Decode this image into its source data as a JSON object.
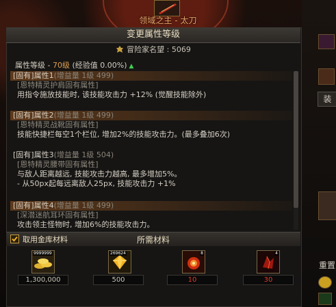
{
  "weapon": {
    "name": "领域之主 - 太刀"
  },
  "dialog": {
    "title": "变更属性等级"
  },
  "fame": {
    "label": "冒险家名望 : 5069"
  },
  "attr_level": {
    "prefix": "属性等级 - ",
    "level": "70级",
    "exp": " (经验值 0.00%)",
    "up_marker": "▲"
  },
  "attributes": [
    {
      "head": "[固有]属性1",
      "gain": "(增益量 1级 499)",
      "source": "[恩特精灵护肩固有属性]",
      "desc": [
        "用指令施放技能时, 该技能攻击力 +12% (觉醒技能除外)"
      ]
    },
    {
      "head": "[固有]属性2",
      "gain": "(增益量 1级 499)",
      "source": "[恩特精灵战靴固有属性]",
      "desc": [
        "技能快捷栏每空1个栏位, 增加2%的技能攻击力。(最多叠加6次)"
      ]
    },
    {
      "head": "[固有]属性3",
      "gain": "(增益量 1级 504)",
      "source": "[恩特精灵腰带固有属性]",
      "desc": [
        "与敌人距离越远, 技能攻击力越高, 最多增加5%。",
        "- 从50px起每远离敌人25px, 技能攻击力 +1%"
      ]
    },
    {
      "head": "[固有]属性4",
      "gain": "(增益量 1级 499)",
      "source": "[深潜迷航耳环固有属性]",
      "desc": [
        "攻击领主怪物时, 增加6%的技能攻击力。"
      ]
    }
  ],
  "materials_bar": {
    "checkbox_label": "取用金库材料",
    "title": "所需材料"
  },
  "materials": [
    {
      "icon": "gold-coins-icon",
      "count": "9999999",
      "value": "1,300,000",
      "color": "#c9c3b6"
    },
    {
      "icon": "gold-gem-icon",
      "count": "269624",
      "value": "500",
      "color": "#c9c3b6"
    },
    {
      "icon": "fire-orb-icon",
      "count": "8",
      "value": "10",
      "color": "#e23a2a"
    },
    {
      "icon": "dark-crystal-icon",
      "count": "4",
      "value": "30",
      "color": "#e23a2a"
    }
  ],
  "side": {
    "tab_label": "装",
    "bottom_label": "重置"
  }
}
